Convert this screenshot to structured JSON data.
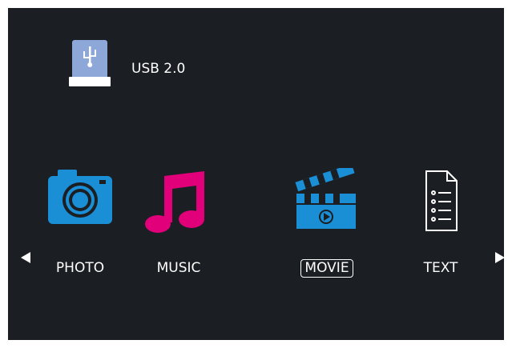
{
  "device": {
    "label": "USB 2.0",
    "icon": "usb-drive-icon"
  },
  "menu": {
    "items": [
      {
        "label": "PHOTO",
        "icon": "camera-icon",
        "color": "#1a8fd6"
      },
      {
        "label": "MUSIC",
        "icon": "music-note-icon",
        "color": "#e2007a"
      },
      {
        "label": "MOVIE",
        "icon": "clapperboard-icon",
        "color": "#1a8fd6",
        "selected": true
      },
      {
        "label": "TEXT",
        "icon": "document-icon",
        "color": "#ffffff"
      }
    ]
  },
  "nav": {
    "left": "arrow-left-icon",
    "right": "arrow-right-icon"
  },
  "colors": {
    "background": "#1b1e23",
    "text": "#ffffff"
  }
}
